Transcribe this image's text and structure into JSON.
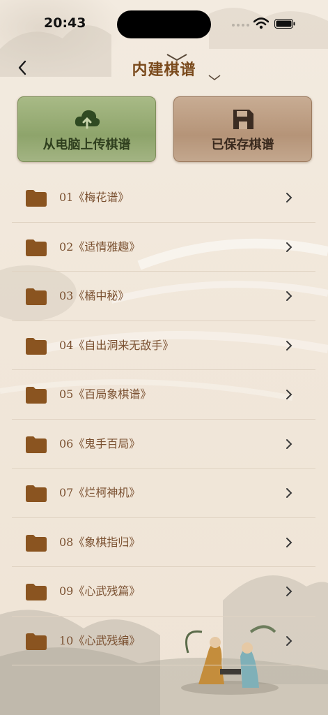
{
  "status_bar": {
    "time": "20:43"
  },
  "header": {
    "title": "内建棋谱"
  },
  "actions": {
    "upload_label": "从电脑上传棋谱",
    "saved_label": "已保存棋谱"
  },
  "manuals": [
    {
      "label": "01《梅花谱》"
    },
    {
      "label": "02《适情雅趣》"
    },
    {
      "label": "03《橘中秘》"
    },
    {
      "label": "04《自出洞来无敌手》"
    },
    {
      "label": "05《百局象棋谱》"
    },
    {
      "label": "06《鬼手百局》"
    },
    {
      "label": "07《烂柯神机》"
    },
    {
      "label": "08《象棋指归》"
    },
    {
      "label": "09《心武残篇》"
    },
    {
      "label": "10《心武残编》"
    }
  ],
  "colors": {
    "title": "#7a4a1c",
    "folder": "#8a5420",
    "upload_card": "#9aad78",
    "saved_card": "#b89a7f"
  },
  "icons": {
    "back": "chevron-left-icon",
    "upload": "cloud-upload-icon",
    "saved": "floppy-disk-icon",
    "folder": "folder-icon",
    "row_arrow": "chevron-right-icon"
  }
}
